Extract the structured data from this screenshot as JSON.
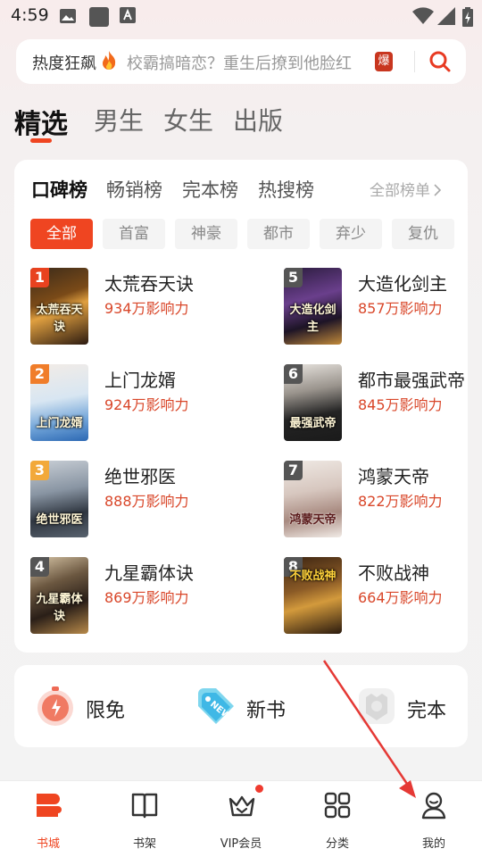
{
  "status_bar": {
    "time": "4:59"
  },
  "search": {
    "hot_label": "热度狂飙",
    "hint": "校霸搞暗恋？重生后撩到他脸红",
    "badge": "爆",
    "icon": "search-icon"
  },
  "top_tabs": [
    {
      "label": "精选",
      "active": true
    },
    {
      "label": "男生",
      "active": false
    },
    {
      "label": "女生",
      "active": false
    },
    {
      "label": "出版",
      "active": false
    }
  ],
  "rank_tabs": [
    {
      "label": "口碑榜",
      "active": true
    },
    {
      "label": "畅销榜",
      "active": false
    },
    {
      "label": "完本榜",
      "active": false
    },
    {
      "label": "热搜榜",
      "active": false
    }
  ],
  "rank_all_label": "全部榜单",
  "chips": [
    {
      "label": "全部",
      "active": true
    },
    {
      "label": "首富",
      "active": false
    },
    {
      "label": "神豪",
      "active": false
    },
    {
      "label": "都市",
      "active": false
    },
    {
      "label": "弃少",
      "active": false
    },
    {
      "label": "复仇",
      "active": false
    }
  ],
  "books": [
    {
      "rank": "1",
      "title": "太荒吞天诀",
      "influence": "934万影响力",
      "cover_text": "太荒吞天诀"
    },
    {
      "rank": "2",
      "title": "上门龙婿",
      "influence": "924万影响力",
      "cover_text": "上门龙婿"
    },
    {
      "rank": "3",
      "title": "绝世邪医",
      "influence": "888万影响力",
      "cover_text": "绝世邪医"
    },
    {
      "rank": "4",
      "title": "九星霸体诀",
      "influence": "869万影响力",
      "cover_text": "九星霸体诀"
    },
    {
      "rank": "5",
      "title": "大造化剑主",
      "influence": "857万影响力",
      "cover_text": "大造化剑主"
    },
    {
      "rank": "6",
      "title": "都市最强武帝",
      "influence": "845万影响力",
      "cover_text": "最强武帝"
    },
    {
      "rank": "7",
      "title": "鸿蒙天帝",
      "influence": "822万影响力",
      "cover_text": "鸿蒙天帝"
    },
    {
      "rank": "8",
      "title": "不败战神",
      "influence": "664万影响力",
      "cover_text": "不败战神"
    }
  ],
  "quick_entries": [
    {
      "label": "限免",
      "icon": "stopwatch-icon"
    },
    {
      "label": "新书",
      "icon": "new-tag-icon"
    },
    {
      "label": "完本",
      "icon": "finished-book-icon"
    }
  ],
  "bottom_nav": [
    {
      "label": "书城",
      "icon": "bookstore-icon",
      "active": true
    },
    {
      "label": "书架",
      "icon": "bookshelf-icon",
      "active": false
    },
    {
      "label": "VIP会员",
      "icon": "crown-icon",
      "active": false
    },
    {
      "label": "分类",
      "icon": "grid-icon",
      "active": false
    },
    {
      "label": "我的",
      "icon": "profile-icon",
      "active": false
    }
  ],
  "colors": {
    "accent": "#ef4521",
    "influence": "#d9472a",
    "rank_1": "#e8421f",
    "rank_2": "#f07d2a",
    "rank_3": "#f2a93a",
    "rank_other": "#555555",
    "annotation_arrow": "#e53935"
  }
}
